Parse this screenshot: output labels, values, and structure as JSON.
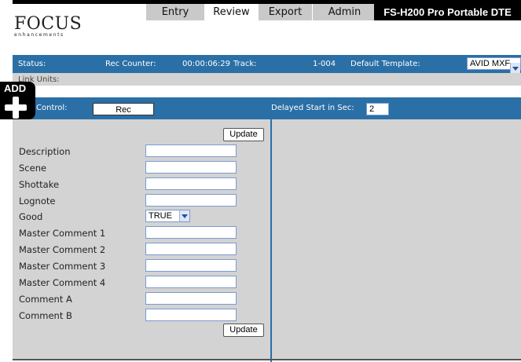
{
  "header": {
    "logo_main": "FOCUS",
    "logo_sub": "enhancements",
    "tabs": [
      {
        "label": "Entry"
      },
      {
        "label": "Review"
      },
      {
        "label": "Export"
      },
      {
        "label": "Admin"
      }
    ],
    "active_tab": "Review",
    "product_title": "FS-H200 Pro Portable DTE"
  },
  "status": {
    "status_label": "Status:",
    "rec_counter_label": "Rec Counter:",
    "rec_counter_value": "00:00:06:29",
    "track_label": "Track:",
    "track_value": "1-004",
    "default_template_label": "Default Template:",
    "default_template_value": "AVID MXF"
  },
  "link_units": {
    "label": "Link Units:"
  },
  "add_widget": {
    "label": "ADD"
  },
  "control": {
    "control_label": "Control:",
    "rec_button": "Rec",
    "delayed_label": "Delayed Start in Sec:",
    "delayed_value": "2"
  },
  "form": {
    "update_label": "Update",
    "fields": [
      {
        "label": "Description",
        "value": ""
      },
      {
        "label": "Scene",
        "value": ""
      },
      {
        "label": "Shottake",
        "value": ""
      },
      {
        "label": "Lognote",
        "value": ""
      },
      {
        "label": "Good",
        "value": "TRUE"
      },
      {
        "label": "Master Comment 1",
        "value": ""
      },
      {
        "label": "Master Comment 2",
        "value": ""
      },
      {
        "label": "Master Comment 3",
        "value": ""
      },
      {
        "label": "Master Comment 4",
        "value": ""
      },
      {
        "label": "Comment A",
        "value": ""
      },
      {
        "label": "Comment B",
        "value": ""
      }
    ]
  },
  "colors": {
    "bar_blue": "#2a6fa6",
    "panel_gray": "#d3d3d3",
    "tab_gray": "#c9c9c9"
  }
}
